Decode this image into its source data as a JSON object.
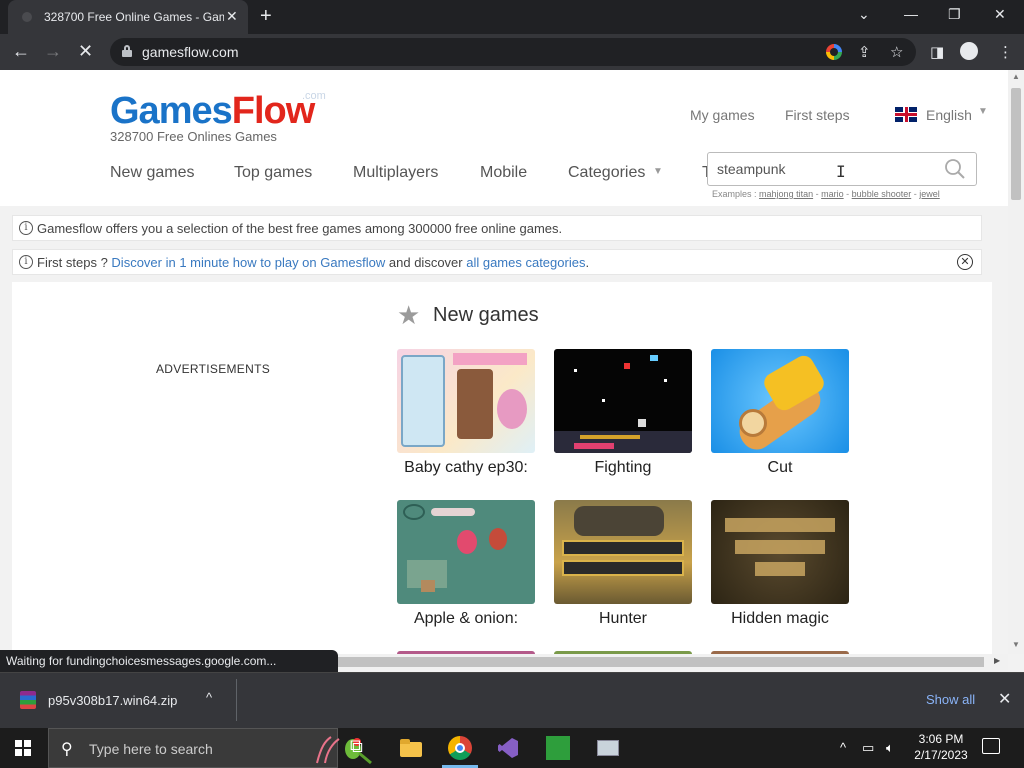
{
  "browser": {
    "tab_title": "328700 Free Online Games - Gam",
    "url": "gamesflow.com",
    "icons": {
      "back": "arrow-left-icon",
      "forward": "arrow-right-icon",
      "stop": "close-icon",
      "new_tab": "plus-icon",
      "tab_close": "close-icon",
      "minimize": "minimize-icon",
      "maximize": "restore-icon",
      "window_close": "close-icon",
      "google_lens": "google-icon",
      "share": "share-icon",
      "bookmark": "star-icon",
      "sidepanel": "side-panel-icon",
      "profile": "person-icon",
      "menu": "kebab-icon"
    }
  },
  "site": {
    "logo_games": "Games",
    "logo_flow": "Flow",
    "logo_com": ".com",
    "tagline": "328700 Free Onlines Games",
    "my_games": "My games",
    "first_steps_link": "First steps",
    "language": "English",
    "menu": [
      "New games",
      "Top games",
      "Multiplayers",
      "Mobile",
      "Categories",
      "T"
    ],
    "search": {
      "value": "steampunk",
      "examples_prefix": "Examples :",
      "examples": [
        "mahjong titan",
        "mario",
        "bubble shooter",
        "jewel"
      ],
      "sep": "-"
    },
    "notice1": "Gamesflow offers you a selection of the best free games among 300000 free online games.",
    "notice2": {
      "prefix": "First steps ? ",
      "link1": "Discover in 1 minute how to play on Gamesflow",
      "middle": " and discover ",
      "link2": "all games categories",
      "suffix": "."
    },
    "section_title": "New games",
    "ads_label": "ADVERTISEMENTS",
    "games": [
      {
        "title": "Baby cathy ep30:"
      },
      {
        "title": "Fighting"
      },
      {
        "title": "Cut"
      },
      {
        "title": "Apple & onion:"
      },
      {
        "title": "Hunter"
      },
      {
        "title": "Hidden magic"
      }
    ]
  },
  "status_text": "Waiting for fundingchoicesmessages.google.com...",
  "download": {
    "filename": "p95v308b17.win64.zip",
    "show_all": "Show all"
  },
  "taskbar": {
    "search_placeholder": "Type here to search",
    "time": "3:06 PM",
    "date": "2/17/2023"
  },
  "colors": {
    "logo_blue": "#1a73c8",
    "logo_red": "#e2261c",
    "link": "#3979c0",
    "chrome_dark": "#35363a"
  }
}
